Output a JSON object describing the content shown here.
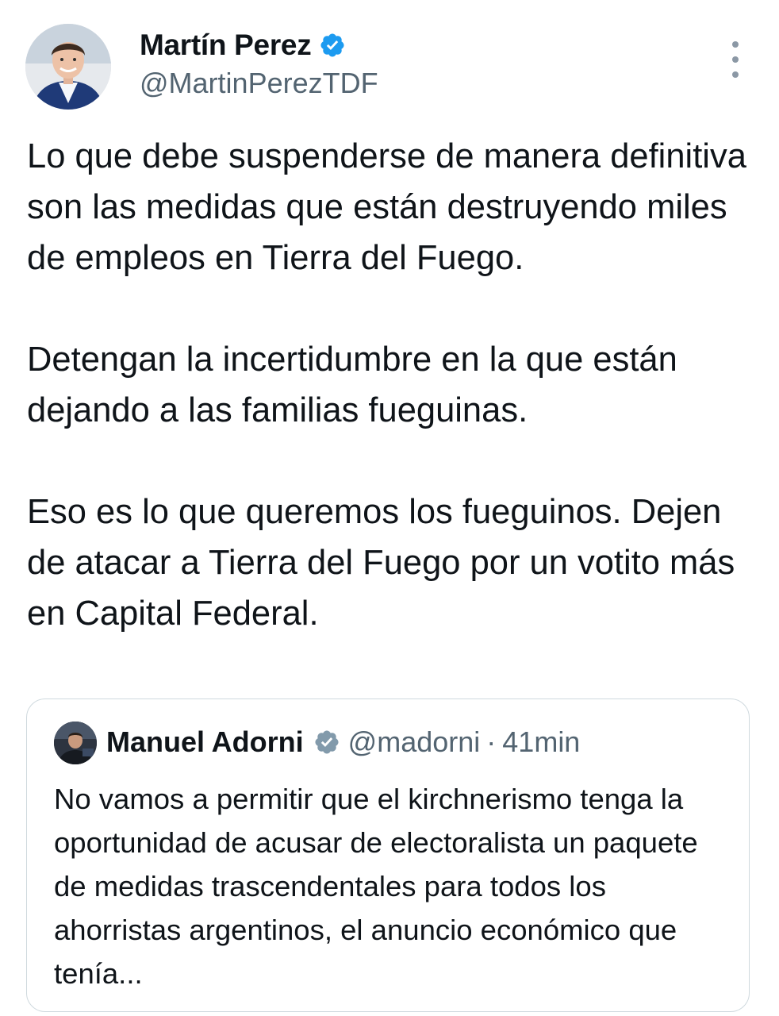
{
  "tweet": {
    "author": {
      "name": "Martín Perez",
      "handle": "@MartinPerezTDF",
      "verified_icon": "verified-badge-icon",
      "verified_color": "#1d9bf0"
    },
    "more_icon": "more-vertical-icon",
    "paragraphs": [
      "Lo que debe suspenderse de manera definitiva son las medidas que están destruyendo miles de empleos en Tierra del Fuego.",
      "Detengan la incertidumbre en la que están dejando a las familias fueguinas.",
      "Eso es lo que queremos los fueguinos. Dejen de atacar a Tierra del Fuego por un votito más en Capital Federal."
    ]
  },
  "quote": {
    "name": "Manuel Adorni",
    "verified_icon": "gray-verified-badge-icon",
    "verified_color": "#829aab",
    "handle": "@madorni",
    "separator": "·",
    "time": "41min",
    "text": "No vamos a permitir que el kirchnerismo tenga la oportunidad de acusar de electoralista un paquete de medidas trascendentales para todos los ahorristas argentinos, el anuncio económico que tenía..."
  },
  "colors": {
    "text_primary": "#0f1419",
    "text_secondary": "#536471",
    "border": "#cfd9de"
  }
}
